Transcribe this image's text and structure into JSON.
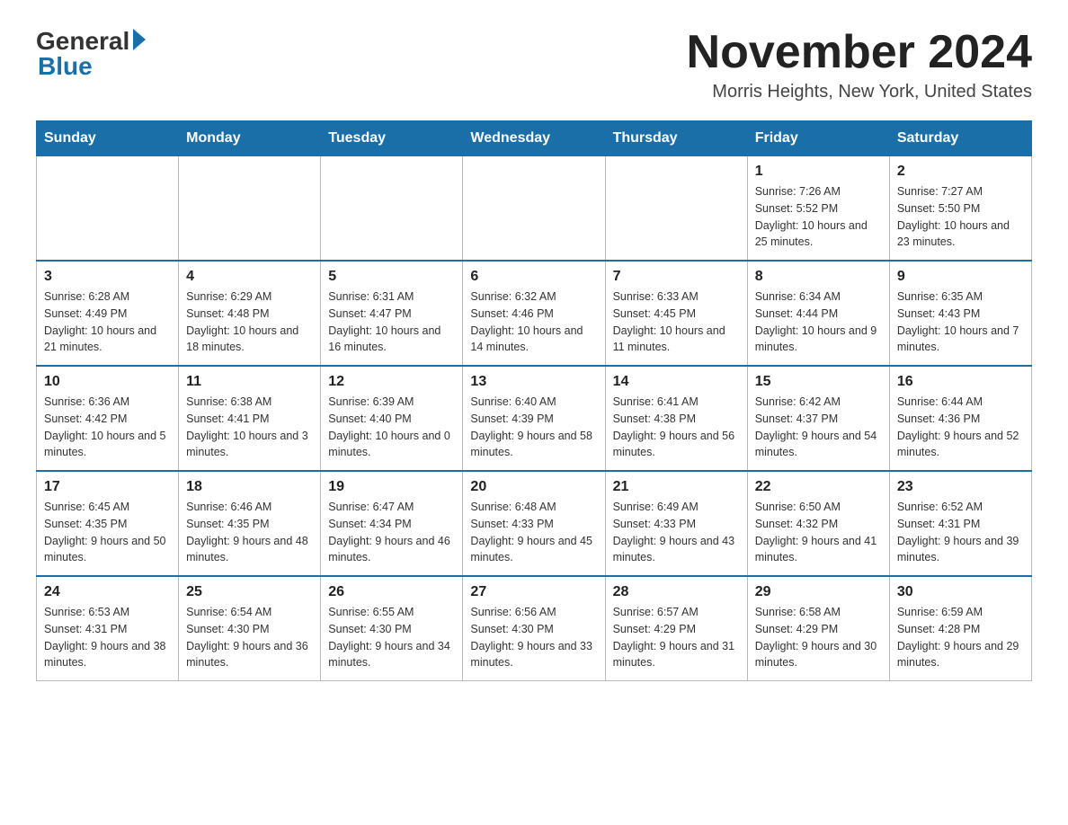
{
  "header": {
    "logo_text": "General",
    "logo_blue": "Blue",
    "month_title": "November 2024",
    "location": "Morris Heights, New York, United States"
  },
  "days_of_week": [
    "Sunday",
    "Monday",
    "Tuesday",
    "Wednesday",
    "Thursday",
    "Friday",
    "Saturday"
  ],
  "weeks": [
    [
      {
        "day": "",
        "info": ""
      },
      {
        "day": "",
        "info": ""
      },
      {
        "day": "",
        "info": ""
      },
      {
        "day": "",
        "info": ""
      },
      {
        "day": "",
        "info": ""
      },
      {
        "day": "1",
        "info": "Sunrise: 7:26 AM\nSunset: 5:52 PM\nDaylight: 10 hours and 25 minutes."
      },
      {
        "day": "2",
        "info": "Sunrise: 7:27 AM\nSunset: 5:50 PM\nDaylight: 10 hours and 23 minutes."
      }
    ],
    [
      {
        "day": "3",
        "info": "Sunrise: 6:28 AM\nSunset: 4:49 PM\nDaylight: 10 hours and 21 minutes."
      },
      {
        "day": "4",
        "info": "Sunrise: 6:29 AM\nSunset: 4:48 PM\nDaylight: 10 hours and 18 minutes."
      },
      {
        "day": "5",
        "info": "Sunrise: 6:31 AM\nSunset: 4:47 PM\nDaylight: 10 hours and 16 minutes."
      },
      {
        "day": "6",
        "info": "Sunrise: 6:32 AM\nSunset: 4:46 PM\nDaylight: 10 hours and 14 minutes."
      },
      {
        "day": "7",
        "info": "Sunrise: 6:33 AM\nSunset: 4:45 PM\nDaylight: 10 hours and 11 minutes."
      },
      {
        "day": "8",
        "info": "Sunrise: 6:34 AM\nSunset: 4:44 PM\nDaylight: 10 hours and 9 minutes."
      },
      {
        "day": "9",
        "info": "Sunrise: 6:35 AM\nSunset: 4:43 PM\nDaylight: 10 hours and 7 minutes."
      }
    ],
    [
      {
        "day": "10",
        "info": "Sunrise: 6:36 AM\nSunset: 4:42 PM\nDaylight: 10 hours and 5 minutes."
      },
      {
        "day": "11",
        "info": "Sunrise: 6:38 AM\nSunset: 4:41 PM\nDaylight: 10 hours and 3 minutes."
      },
      {
        "day": "12",
        "info": "Sunrise: 6:39 AM\nSunset: 4:40 PM\nDaylight: 10 hours and 0 minutes."
      },
      {
        "day": "13",
        "info": "Sunrise: 6:40 AM\nSunset: 4:39 PM\nDaylight: 9 hours and 58 minutes."
      },
      {
        "day": "14",
        "info": "Sunrise: 6:41 AM\nSunset: 4:38 PM\nDaylight: 9 hours and 56 minutes."
      },
      {
        "day": "15",
        "info": "Sunrise: 6:42 AM\nSunset: 4:37 PM\nDaylight: 9 hours and 54 minutes."
      },
      {
        "day": "16",
        "info": "Sunrise: 6:44 AM\nSunset: 4:36 PM\nDaylight: 9 hours and 52 minutes."
      }
    ],
    [
      {
        "day": "17",
        "info": "Sunrise: 6:45 AM\nSunset: 4:35 PM\nDaylight: 9 hours and 50 minutes."
      },
      {
        "day": "18",
        "info": "Sunrise: 6:46 AM\nSunset: 4:35 PM\nDaylight: 9 hours and 48 minutes."
      },
      {
        "day": "19",
        "info": "Sunrise: 6:47 AM\nSunset: 4:34 PM\nDaylight: 9 hours and 46 minutes."
      },
      {
        "day": "20",
        "info": "Sunrise: 6:48 AM\nSunset: 4:33 PM\nDaylight: 9 hours and 45 minutes."
      },
      {
        "day": "21",
        "info": "Sunrise: 6:49 AM\nSunset: 4:33 PM\nDaylight: 9 hours and 43 minutes."
      },
      {
        "day": "22",
        "info": "Sunrise: 6:50 AM\nSunset: 4:32 PM\nDaylight: 9 hours and 41 minutes."
      },
      {
        "day": "23",
        "info": "Sunrise: 6:52 AM\nSunset: 4:31 PM\nDaylight: 9 hours and 39 minutes."
      }
    ],
    [
      {
        "day": "24",
        "info": "Sunrise: 6:53 AM\nSunset: 4:31 PM\nDaylight: 9 hours and 38 minutes."
      },
      {
        "day": "25",
        "info": "Sunrise: 6:54 AM\nSunset: 4:30 PM\nDaylight: 9 hours and 36 minutes."
      },
      {
        "day": "26",
        "info": "Sunrise: 6:55 AM\nSunset: 4:30 PM\nDaylight: 9 hours and 34 minutes."
      },
      {
        "day": "27",
        "info": "Sunrise: 6:56 AM\nSunset: 4:30 PM\nDaylight: 9 hours and 33 minutes."
      },
      {
        "day": "28",
        "info": "Sunrise: 6:57 AM\nSunset: 4:29 PM\nDaylight: 9 hours and 31 minutes."
      },
      {
        "day": "29",
        "info": "Sunrise: 6:58 AM\nSunset: 4:29 PM\nDaylight: 9 hours and 30 minutes."
      },
      {
        "day": "30",
        "info": "Sunrise: 6:59 AM\nSunset: 4:28 PM\nDaylight: 9 hours and 29 minutes."
      }
    ]
  ]
}
